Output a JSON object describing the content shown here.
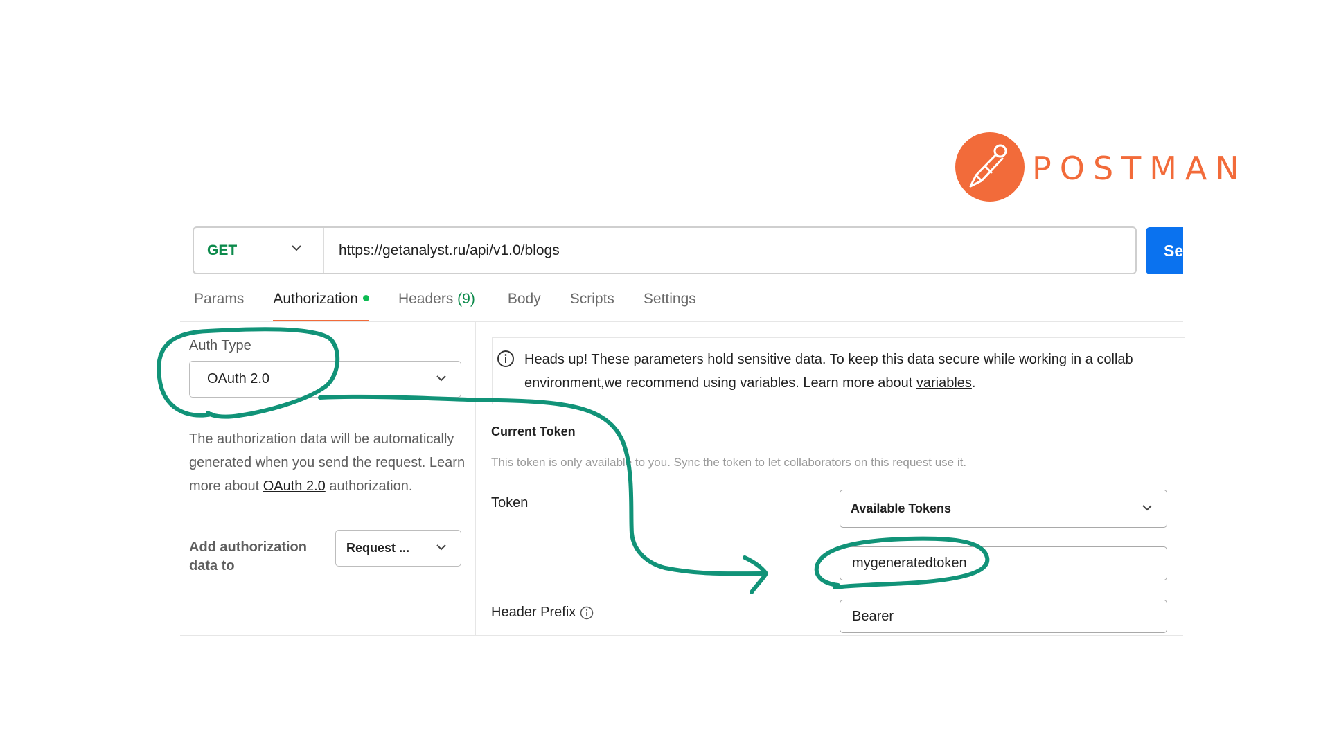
{
  "brand": {
    "name": "POSTMAN",
    "color": "#f26b3a"
  },
  "request": {
    "method": "GET",
    "url": "https://getanalyst.ru/api/v1.0/blogs",
    "send_label": "Send"
  },
  "tabs": [
    {
      "label": "Params",
      "active": false
    },
    {
      "label": "Authorization",
      "active": true
    },
    {
      "label": "Headers",
      "count": "(9)",
      "active": false
    },
    {
      "label": "Body",
      "active": false
    },
    {
      "label": "Scripts",
      "active": false
    },
    {
      "label": "Settings",
      "active": false
    }
  ],
  "auth": {
    "type_label": "Auth Type",
    "type_value": "OAuth 2.0",
    "description_before": "The authorization data will be automatically generated when you send the request. Learn more about ",
    "description_link": "OAuth 2.0",
    "description_after": " authorization.",
    "add_to_label": "Add authorization data to",
    "add_to_value": "Request ..."
  },
  "notice": {
    "line1": "Heads up! These parameters hold sensitive data. To keep this data secure while working in a collab",
    "line2_before": "environment,we recommend using variables. Learn more about ",
    "line2_link": "variables",
    "line2_after": "."
  },
  "current_token": {
    "title": "Current Token",
    "note": "This token is only available to you. Sync the token to let collaborators on this request use it.",
    "token_label": "Token",
    "available_tokens": "Available Tokens",
    "token_value": "mygeneratedtoken",
    "header_prefix_label": "Header Prefix",
    "header_prefix_value": "Bearer"
  },
  "colors": {
    "accent": "#f26b3a",
    "send": "#0a72ef",
    "method": "#0c8a4b",
    "annotation": "#119378"
  }
}
